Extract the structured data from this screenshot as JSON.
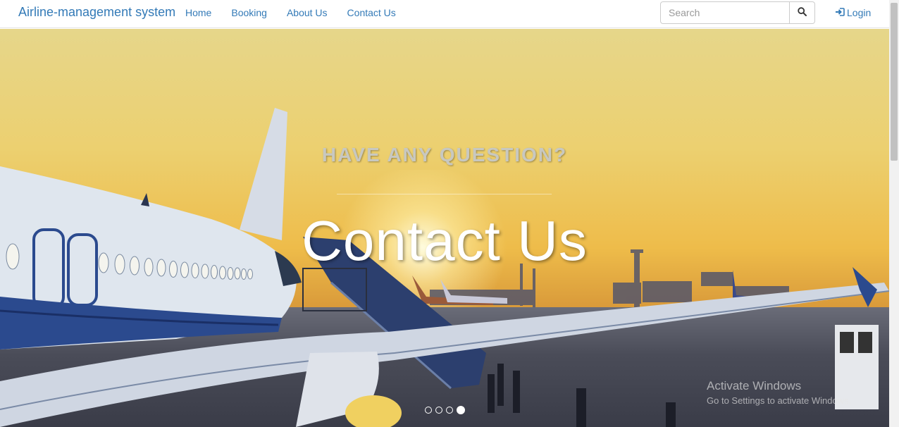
{
  "navbar": {
    "brand": "Airline-management system",
    "links": [
      "Home",
      "Booking",
      "About Us",
      "Contact Us"
    ],
    "search": {
      "placeholder": "Search",
      "value": ""
    },
    "login_label": "Login",
    "icons": {
      "search": "search-icon",
      "login": "login-icon"
    }
  },
  "hero": {
    "heading": "HAVE ANY QUESTION?",
    "title": "Contact Us",
    "carousel": {
      "slides": 4,
      "active": 4
    },
    "watermark": {
      "line1": "Activate Windows",
      "line2": "Go to Settings to activate Windows."
    }
  },
  "colors": {
    "link": "#337ab7",
    "title": "#ffffff",
    "heading": "#c8c8c0"
  }
}
